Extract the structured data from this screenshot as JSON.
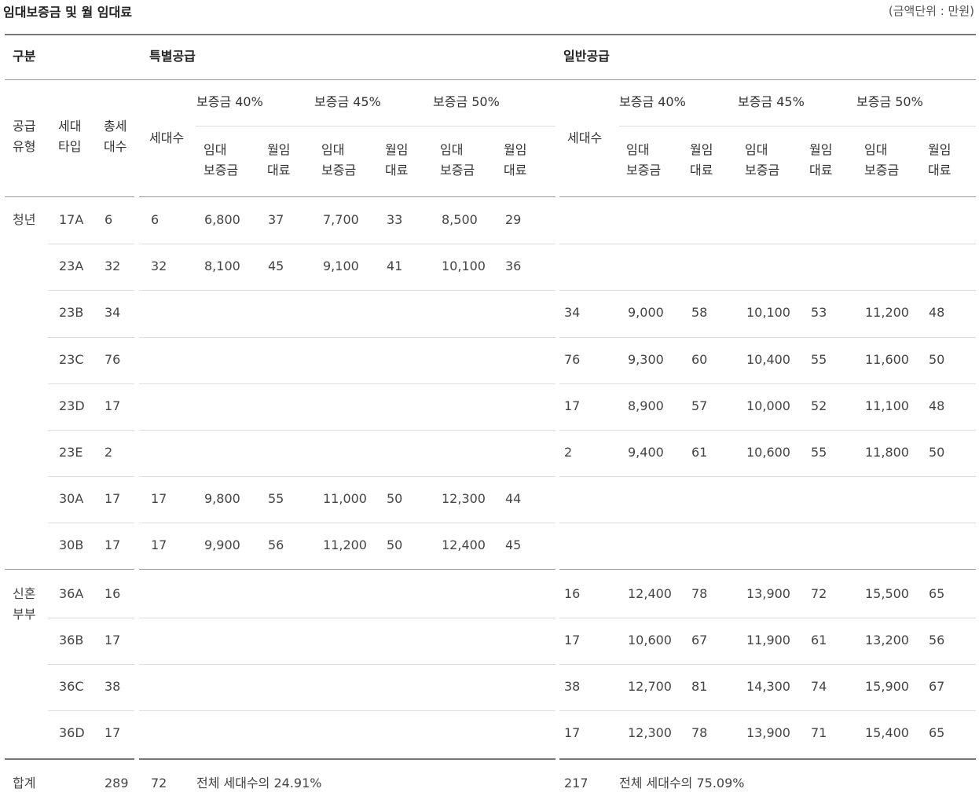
{
  "title": "임대보증금 및 월 임대료",
  "unit": "(금액단위 : 만원)",
  "header": {
    "gubun": "구분",
    "special": "특별공급",
    "general": "일반공급",
    "supply_type": [
      "공급",
      "유형"
    ],
    "unit_type": [
      "세대",
      "타입"
    ],
    "total_units": [
      "총세",
      "대수"
    ],
    "households": "세대수",
    "deposit_40": "보증금 40%",
    "deposit_45": "보증금 45%",
    "deposit_50": "보증금 50%",
    "rent_deposit": [
      "임대",
      "보증금"
    ],
    "monthly_rent": [
      "월임",
      "대료"
    ]
  },
  "groups": [
    {
      "name": [
        "청년"
      ],
      "rows": [
        {
          "type": "17A",
          "total": "6",
          "sp": [
            "6",
            "6,800",
            "37",
            "7,700",
            "33",
            "8,500",
            "29"
          ],
          "gen": []
        },
        {
          "type": "23A",
          "total": "32",
          "sp": [
            "32",
            "8,100",
            "45",
            "9,100",
            "41",
            "10,100",
            "36"
          ],
          "gen": []
        },
        {
          "type": "23B",
          "total": "34",
          "sp": [],
          "gen": [
            "34",
            "9,000",
            "58",
            "10,100",
            "53",
            "11,200",
            "48"
          ]
        },
        {
          "type": "23C",
          "total": "76",
          "sp": [],
          "gen": [
            "76",
            "9,300",
            "60",
            "10,400",
            "55",
            "11,600",
            "50"
          ]
        },
        {
          "type": "23D",
          "total": "17",
          "sp": [],
          "gen": [
            "17",
            "8,900",
            "57",
            "10,000",
            "52",
            "11,100",
            "48"
          ]
        },
        {
          "type": "23E",
          "total": "2",
          "sp": [],
          "gen": [
            "2",
            "9,400",
            "61",
            "10,600",
            "55",
            "11,800",
            "50"
          ]
        },
        {
          "type": "30A",
          "total": "17",
          "sp": [
            "17",
            "9,800",
            "55",
            "11,000",
            "50",
            "12,300",
            "44"
          ],
          "gen": []
        },
        {
          "type": "30B",
          "total": "17",
          "sp": [
            "17",
            "9,900",
            "56",
            "11,200",
            "50",
            "12,400",
            "45"
          ],
          "gen": []
        }
      ]
    },
    {
      "name": [
        "신혼",
        "부부"
      ],
      "rows": [
        {
          "type": "36A",
          "total": "16",
          "sp": [],
          "gen": [
            "16",
            "12,400",
            "78",
            "13,900",
            "72",
            "15,500",
            "65"
          ]
        },
        {
          "type": "36B",
          "total": "17",
          "sp": [],
          "gen": [
            "17",
            "10,600",
            "67",
            "11,900",
            "61",
            "13,200",
            "56"
          ]
        },
        {
          "type": "36C",
          "total": "38",
          "sp": [],
          "gen": [
            "38",
            "12,700",
            "81",
            "14,300",
            "74",
            "15,900",
            "67"
          ]
        },
        {
          "type": "36D",
          "total": "17",
          "sp": [],
          "gen": [
            "17",
            "12,300",
            "78",
            "13,900",
            "71",
            "15,400",
            "65"
          ]
        }
      ]
    }
  ],
  "total": {
    "label": "합계",
    "total_units": "289",
    "special_units": "72",
    "special_note": "전체 세대수의 24.91%",
    "general_units": "217",
    "general_note": "전체 세대수의 75.09%"
  }
}
